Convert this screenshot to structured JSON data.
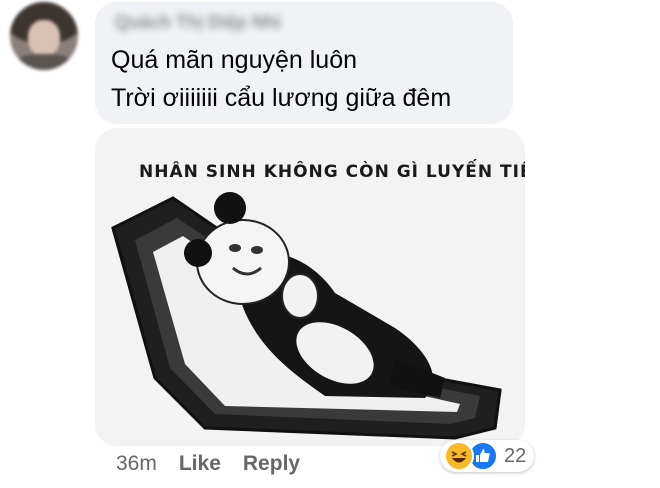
{
  "comment": {
    "author": "Quách Thị Diệp Nhi",
    "lines": [
      "Quá mãn nguyện luôn",
      "Trời ơiiiiiii cẩu lương giữa đêm"
    ]
  },
  "attachment": {
    "caption": "NHÂN SINH KHÔNG CÒN GÌ LUYẾN TIẾC"
  },
  "actions": {
    "time": "36m",
    "like_label": "Like",
    "reply_label": "Reply"
  },
  "reactions": {
    "icons": [
      "haha-icon",
      "like-icon"
    ],
    "count": "22",
    "colors": {
      "haha": "#f7b928",
      "like": "#1877f2"
    }
  }
}
